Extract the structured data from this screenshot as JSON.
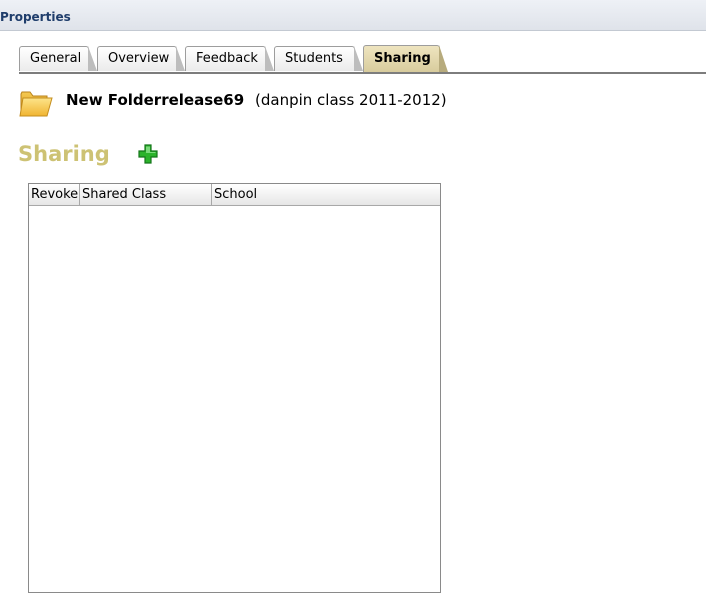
{
  "panel": {
    "title": "Properties"
  },
  "tabs": [
    {
      "label": "General",
      "active": false
    },
    {
      "label": "Overview",
      "active": false
    },
    {
      "label": "Feedback",
      "active": false
    },
    {
      "label": "Students",
      "active": false
    },
    {
      "label": "Sharing",
      "active": true
    }
  ],
  "folder": {
    "icon": "folder-icon",
    "name": "New Folderrelease69",
    "class_info": "(danpin class 2011-2012)"
  },
  "sharing": {
    "title": "Sharing",
    "add_icon": "green-plus-icon",
    "columns": [
      "Revoke",
      "Shared Class",
      "School"
    ],
    "rows": []
  },
  "colors": {
    "section_title": "#cdc274",
    "active_tab": "#d8cc9d",
    "add_icon": "#2bb32b"
  }
}
